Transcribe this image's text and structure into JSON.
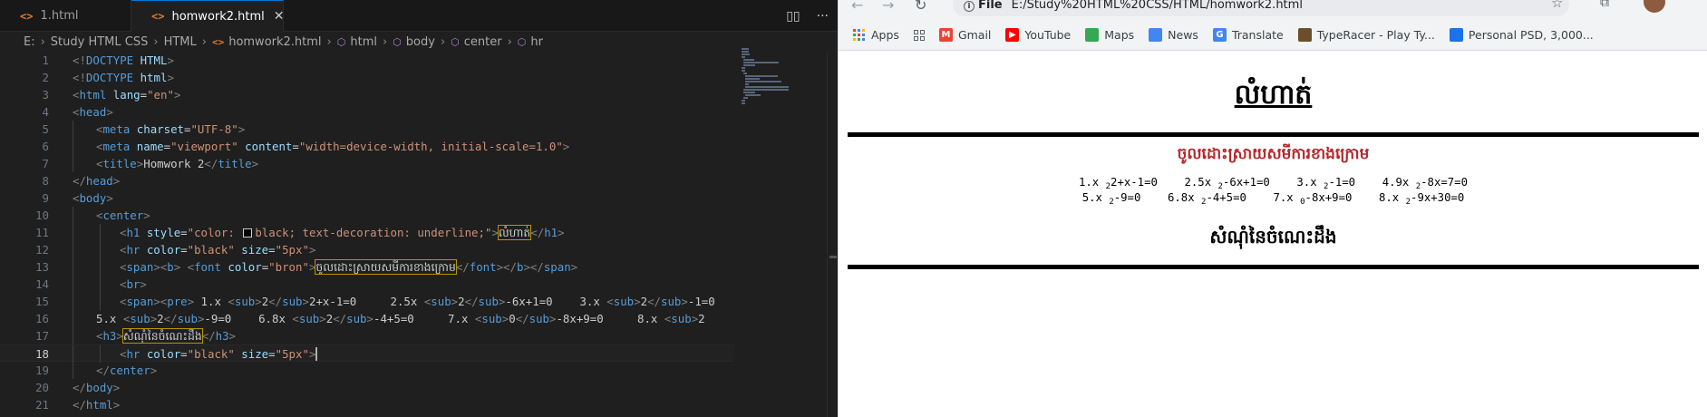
{
  "editor": {
    "tabs": [
      {
        "label": "1.html",
        "active": false
      },
      {
        "label": "homwork2.html",
        "active": true
      }
    ],
    "tab_close_glyph": "✕",
    "file_icon": "<>",
    "breadcrumb": [
      "E:",
      "Study HTML CSS",
      "HTML",
      "homwork2.html",
      "html",
      "body",
      "center",
      "hr"
    ],
    "current_line": 18,
    "lines": [
      {
        "n": 1,
        "indent": 0,
        "parts": [
          [
            "br",
            "<!"
          ],
          [
            "tag",
            "DOCTYPE"
          ],
          [
            "attr",
            " HTML"
          ],
          [
            "br",
            ">"
          ]
        ]
      },
      {
        "n": 2,
        "indent": 0,
        "parts": [
          [
            "br",
            "<!"
          ],
          [
            "tag",
            "DOCTYPE"
          ],
          [
            "attr",
            " html"
          ],
          [
            "br",
            ">"
          ]
        ]
      },
      {
        "n": 3,
        "indent": 0,
        "parts": [
          [
            "br",
            "<"
          ],
          [
            "tag",
            "html"
          ],
          [
            "attr",
            " lang"
          ],
          [
            "txt",
            "="
          ],
          [
            "str",
            "\"en\""
          ],
          [
            "br",
            ">"
          ]
        ]
      },
      {
        "n": 4,
        "indent": 0,
        "parts": [
          [
            "br",
            "<"
          ],
          [
            "tag",
            "head"
          ],
          [
            "br",
            ">"
          ]
        ]
      },
      {
        "n": 5,
        "indent": 1,
        "parts": [
          [
            "br",
            "<"
          ],
          [
            "tag",
            "meta"
          ],
          [
            "attr",
            " charset"
          ],
          [
            "txt",
            "="
          ],
          [
            "str",
            "\"UTF-8\""
          ],
          [
            "br",
            ">"
          ]
        ]
      },
      {
        "n": 6,
        "indent": 1,
        "parts": [
          [
            "br",
            "<"
          ],
          [
            "tag",
            "meta"
          ],
          [
            "attr",
            " name"
          ],
          [
            "txt",
            "="
          ],
          [
            "str",
            "\"viewport\""
          ],
          [
            "attr",
            " content"
          ],
          [
            "txt",
            "="
          ],
          [
            "str",
            "\"width=device-width, initial-scale=1.0\""
          ],
          [
            "br",
            ">"
          ]
        ]
      },
      {
        "n": 7,
        "indent": 1,
        "parts": [
          [
            "br",
            "<"
          ],
          [
            "tag",
            "title"
          ],
          [
            "br",
            ">"
          ],
          [
            "txt",
            "Homwork 2"
          ],
          [
            "br",
            "</"
          ],
          [
            "tag",
            "title"
          ],
          [
            "br",
            ">"
          ]
        ]
      },
      {
        "n": 8,
        "indent": 0,
        "parts": [
          [
            "br",
            "</"
          ],
          [
            "tag",
            "head"
          ],
          [
            "br",
            ">"
          ]
        ]
      },
      {
        "n": 9,
        "indent": 0,
        "parts": [
          [
            "br",
            "<"
          ],
          [
            "tag",
            "body"
          ],
          [
            "br",
            ">"
          ]
        ]
      },
      {
        "n": 10,
        "indent": 1,
        "parts": [
          [
            "br",
            "<"
          ],
          [
            "tag",
            "center"
          ],
          [
            "br",
            ">"
          ]
        ]
      },
      {
        "n": 11,
        "indent": 2,
        "parts": [
          [
            "br",
            "<"
          ],
          [
            "tag",
            "h1"
          ],
          [
            "attr",
            " style"
          ],
          [
            "txt",
            "="
          ],
          [
            "str",
            "\"color: "
          ],
          [
            "swatch",
            ""
          ],
          [
            "str",
            "black; text-decoration: underline;\""
          ],
          [
            "br",
            ">"
          ],
          [
            "hl",
            "លំហាត់"
          ],
          [
            "br",
            "</"
          ],
          [
            "tag",
            "h1"
          ],
          [
            "br",
            ">"
          ]
        ]
      },
      {
        "n": 12,
        "indent": 2,
        "parts": [
          [
            "br",
            "<"
          ],
          [
            "tag",
            "hr"
          ],
          [
            "attr",
            " color"
          ],
          [
            "txt",
            "="
          ],
          [
            "str",
            "\"black\""
          ],
          [
            "attr",
            " size"
          ],
          [
            "txt",
            "="
          ],
          [
            "str",
            "\"5px\""
          ],
          [
            "br",
            ">"
          ]
        ]
      },
      {
        "n": 13,
        "indent": 2,
        "parts": [
          [
            "br",
            "<"
          ],
          [
            "tag",
            "span"
          ],
          [
            "br",
            "><"
          ],
          [
            "tag",
            "b"
          ],
          [
            "br",
            "> <"
          ],
          [
            "tag",
            "font"
          ],
          [
            "attr",
            " color"
          ],
          [
            "txt",
            "="
          ],
          [
            "str",
            "\"bron\""
          ],
          [
            "br",
            ">"
          ],
          [
            "hl",
            "ចូលដោះស្រាយសមីការខាងក្រោម"
          ],
          [
            "br",
            "</"
          ],
          [
            "tag",
            "font"
          ],
          [
            "br",
            "></"
          ],
          [
            "tag",
            "b"
          ],
          [
            "br",
            "></"
          ],
          [
            "tag",
            "span"
          ],
          [
            "br",
            ">"
          ]
        ]
      },
      {
        "n": 14,
        "indent": 2,
        "parts": [
          [
            "br",
            "<"
          ],
          [
            "tag",
            "br"
          ],
          [
            "br",
            ">"
          ]
        ]
      },
      {
        "n": 15,
        "indent": 2,
        "parts": [
          [
            "br",
            "<"
          ],
          [
            "tag",
            "span"
          ],
          [
            "br",
            "><"
          ],
          [
            "tag",
            "pre"
          ],
          [
            "br",
            ">"
          ],
          [
            "txt",
            " 1.x "
          ],
          [
            "br",
            "<"
          ],
          [
            "tag",
            "sub"
          ],
          [
            "br",
            ">"
          ],
          [
            "txt",
            "2"
          ],
          [
            "br",
            "</"
          ],
          [
            "tag",
            "sub"
          ],
          [
            "br",
            ">"
          ],
          [
            "txt",
            "2+x-1=0     2.5x "
          ],
          [
            "br",
            "<"
          ],
          [
            "tag",
            "sub"
          ],
          [
            "br",
            ">"
          ],
          [
            "txt",
            "2"
          ],
          [
            "br",
            "</"
          ],
          [
            "tag",
            "sub"
          ],
          [
            "br",
            ">"
          ],
          [
            "txt",
            "-6x+1=0    3.x "
          ],
          [
            "br",
            "<"
          ],
          [
            "tag",
            "sub"
          ],
          [
            "br",
            ">"
          ],
          [
            "txt",
            "2"
          ],
          [
            "br",
            "</"
          ],
          [
            "tag",
            "sub"
          ],
          [
            "br",
            ">"
          ],
          [
            "txt",
            "-1=0"
          ]
        ]
      },
      {
        "n": 16,
        "indent": 1,
        "parts": [
          [
            "txt",
            "5.x "
          ],
          [
            "br",
            "<"
          ],
          [
            "tag",
            "sub"
          ],
          [
            "br",
            ">"
          ],
          [
            "txt",
            "2"
          ],
          [
            "br",
            "</"
          ],
          [
            "tag",
            "sub"
          ],
          [
            "br",
            ">"
          ],
          [
            "txt",
            "-9=0    6.8x "
          ],
          [
            "br",
            "<"
          ],
          [
            "tag",
            "sub"
          ],
          [
            "br",
            ">"
          ],
          [
            "txt",
            "2"
          ],
          [
            "br",
            "</"
          ],
          [
            "tag",
            "sub"
          ],
          [
            "br",
            ">"
          ],
          [
            "txt",
            "-4+5=0     7.x "
          ],
          [
            "br",
            "<"
          ],
          [
            "tag",
            "sub"
          ],
          [
            "br",
            ">"
          ],
          [
            "txt",
            "0"
          ],
          [
            "br",
            "</"
          ],
          [
            "tag",
            "sub"
          ],
          [
            "br",
            ">"
          ],
          [
            "txt",
            "-8x+9=0     8.x "
          ],
          [
            "br",
            "<"
          ],
          [
            "tag",
            "sub"
          ],
          [
            "br",
            ">"
          ],
          [
            "txt",
            "2"
          ]
        ]
      },
      {
        "n": 17,
        "indent": 1,
        "parts": [
          [
            "br",
            "<"
          ],
          [
            "tag",
            "h3"
          ],
          [
            "br",
            ">"
          ],
          [
            "hl",
            "សំណុំនៃចំណេះដឹង"
          ],
          [
            "br",
            "</"
          ],
          [
            "tag",
            "h3"
          ],
          [
            "br",
            ">"
          ]
        ]
      },
      {
        "n": 18,
        "indent": 2,
        "parts": [
          [
            "br",
            "<"
          ],
          [
            "tag",
            "hr"
          ],
          [
            "attr",
            " color"
          ],
          [
            "txt",
            "="
          ],
          [
            "str",
            "\"black\""
          ],
          [
            "attr",
            " size"
          ],
          [
            "txt",
            "="
          ],
          [
            "str",
            "\"5px\""
          ],
          [
            "br",
            ">"
          ],
          [
            "cursor",
            ""
          ]
        ]
      },
      {
        "n": 19,
        "indent": 1,
        "parts": [
          [
            "br",
            "</"
          ],
          [
            "tag",
            "center"
          ],
          [
            "br",
            ">"
          ]
        ]
      },
      {
        "n": 20,
        "indent": 0,
        "parts": [
          [
            "br",
            "</"
          ],
          [
            "tag",
            "body"
          ],
          [
            "br",
            ">"
          ]
        ]
      },
      {
        "n": 21,
        "indent": 0,
        "parts": [
          [
            "br",
            "</"
          ],
          [
            "tag",
            "html"
          ],
          [
            "br",
            ">"
          ]
        ]
      }
    ]
  },
  "browser": {
    "address_chip": "File",
    "url": "E:/Study%20HTML%20CSS/HTML/homwork2.html",
    "bookmarks": [
      {
        "label": "Apps",
        "icon": "apps-grid"
      },
      {
        "label": "",
        "icon": "tab-groups"
      },
      {
        "label": "Gmail",
        "icon": "gmail",
        "color": "#ea4335"
      },
      {
        "label": "YouTube",
        "icon": "youtube",
        "color": "#ff0000"
      },
      {
        "label": "Maps",
        "icon": "maps",
        "color": "#34a853"
      },
      {
        "label": "News",
        "icon": "news",
        "color": "#4285f4"
      },
      {
        "label": "Translate",
        "icon": "translate",
        "color": "#4285f4"
      },
      {
        "label": "TypeRacer - Play Ty...",
        "icon": "typeracer",
        "color": "#6b4f2a"
      },
      {
        "label": "Personal PSD, 3,000...",
        "icon": "psd",
        "color": "#1a73e8"
      }
    ],
    "page": {
      "title": "លំហាត់",
      "subtitle": "ចូលដោះស្រាយសមីការខាងក្រោម",
      "subtitle_color": "#b5272a",
      "equations_row1": [
        {
          "prefix": "1.x ",
          "sub": "2",
          "rest": "2+x-1=0"
        },
        {
          "prefix": "2.5x ",
          "sub": "2",
          "rest": "-6x+1=0"
        },
        {
          "prefix": "3.x ",
          "sub": "2",
          "rest": "-1=0"
        },
        {
          "prefix": "4.9x ",
          "sub": "2",
          "rest": "-8x=7=0"
        }
      ],
      "equations_row2": [
        {
          "prefix": "5.x ",
          "sub": "2",
          "rest": "-9=0"
        },
        {
          "prefix": "6.8x ",
          "sub": "2",
          "rest": "-4+5=0"
        },
        {
          "prefix": "7.x ",
          "sub": "0",
          "rest": "-8x+9=0"
        },
        {
          "prefix": "8.x ",
          "sub": "2",
          "rest": "-9x+30=0"
        }
      ],
      "heading3": "សំណុំនៃចំណេះដឹង"
    }
  }
}
